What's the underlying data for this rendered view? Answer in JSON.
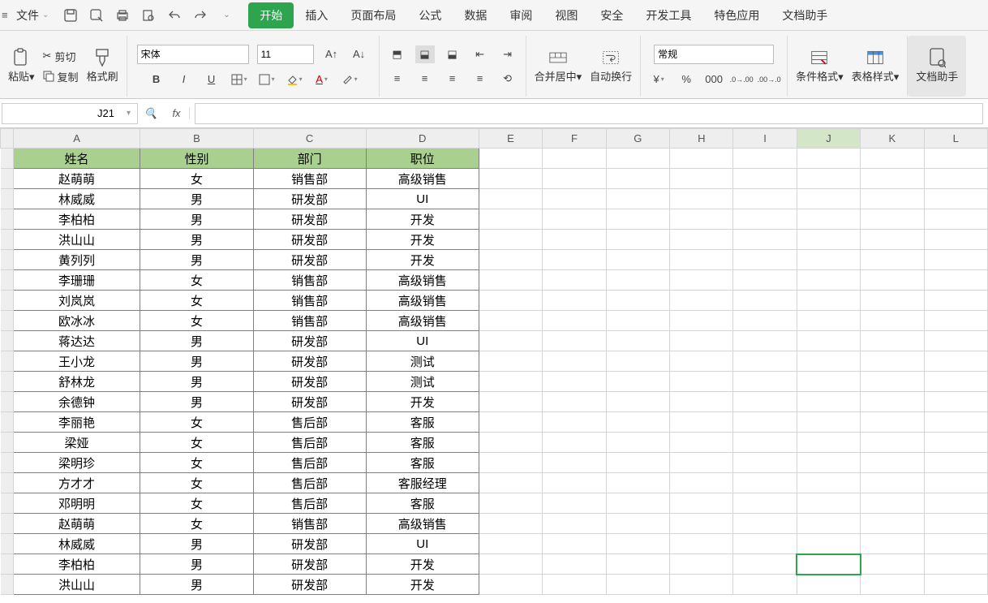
{
  "menu": {
    "file": "文件",
    "tabs": [
      "开始",
      "插入",
      "页面布局",
      "公式",
      "数据",
      "审阅",
      "视图",
      "安全",
      "开发工具",
      "特色应用",
      "文档助手"
    ],
    "active_tab": 0
  },
  "ribbon": {
    "cut": "剪切",
    "copy": "复制",
    "paste": "粘贴",
    "formatpainter": "格式刷",
    "font": "宋体",
    "fontsize": "11",
    "merge": "合并居中",
    "wrap": "自动换行",
    "format": "常规",
    "condformat": "条件格式",
    "tablestyle": "表格样式",
    "assistant": "文档助手"
  },
  "formulabar": {
    "cellref": "J21",
    "fx": "fx",
    "value": ""
  },
  "columns": [
    "A",
    "B",
    "C",
    "D",
    "E",
    "F",
    "G",
    "H",
    "I",
    "J",
    "K",
    "L"
  ],
  "colwidths": [
    "colA",
    "colB",
    "colC",
    "colD",
    "colE",
    "colF",
    "colG",
    "colH",
    "colI",
    "colJ",
    "colK",
    "colL"
  ],
  "headers": [
    "姓名",
    "性别",
    "部门",
    "职位"
  ],
  "rows": [
    [
      "赵萌萌",
      "女",
      "销售部",
      "高级销售"
    ],
    [
      "林威威",
      "男",
      "研发部",
      "UI"
    ],
    [
      "李柏柏",
      "男",
      "研发部",
      "开发"
    ],
    [
      "洪山山",
      "男",
      "研发部",
      "开发"
    ],
    [
      "黄列列",
      "男",
      "研发部",
      "开发"
    ],
    [
      "李珊珊",
      "女",
      "销售部",
      "高级销售"
    ],
    [
      "刘岚岚",
      "女",
      "销售部",
      "高级销售"
    ],
    [
      "欧冰冰",
      "女",
      "销售部",
      "高级销售"
    ],
    [
      "蒋达达",
      "男",
      "研发部",
      "UI"
    ],
    [
      "王小龙",
      "男",
      "研发部",
      "测试"
    ],
    [
      "舒林龙",
      "男",
      "研发部",
      "测试"
    ],
    [
      "余德钟",
      "男",
      "研发部",
      "开发"
    ],
    [
      "李丽艳",
      "女",
      "售后部",
      "客服"
    ],
    [
      "梁娅",
      "女",
      "售后部",
      "客服"
    ],
    [
      "梁明珍",
      "女",
      "售后部",
      "客服"
    ],
    [
      "方才才",
      "女",
      "售后部",
      "客服经理"
    ],
    [
      "邓明明",
      "女",
      "售后部",
      "客服"
    ],
    [
      "赵萌萌",
      "女",
      "销售部",
      "高级销售"
    ],
    [
      "林威威",
      "男",
      "研发部",
      "UI"
    ],
    [
      "李柏柏",
      "男",
      "研发部",
      "开发"
    ],
    [
      "洪山山",
      "男",
      "研发部",
      "开发"
    ]
  ],
  "selected": {
    "col": "J",
    "row": 21
  }
}
